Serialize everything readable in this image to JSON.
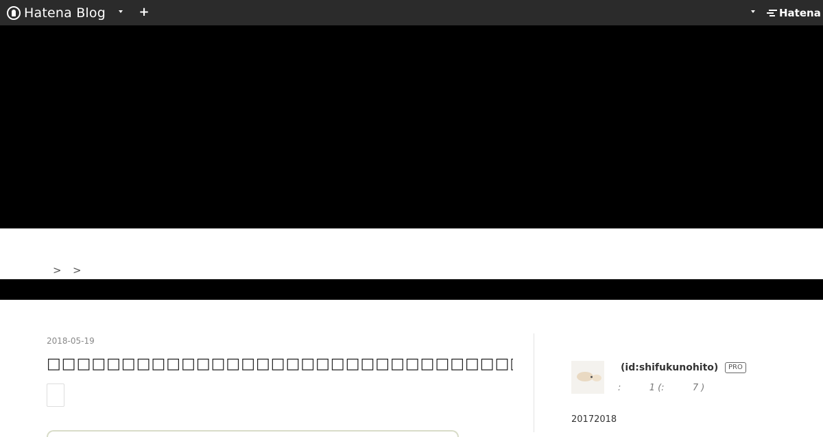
{
  "globalbar": {
    "brand": "Hatena Blog",
    "plus": "+",
    "right_brand": "Hatena"
  },
  "breadcrumb": {
    "separators": [
      ">",
      ">"
    ]
  },
  "article": {
    "date": "2018-05-19",
    "title": "□□□□□□□□□□□□□□□□□□□□□□□□□□□□□□□□□□□□□"
  },
  "sidebar": {
    "profile_id": "(id:shifukunohito)",
    "badge": "PRO",
    "stats": ":          1 (:          7 )",
    "archive": "20172018"
  },
  "colors": {
    "globalbar_bg": "#2b2b2b",
    "hero_bg": "#000000",
    "nav_bg": "#000000"
  }
}
